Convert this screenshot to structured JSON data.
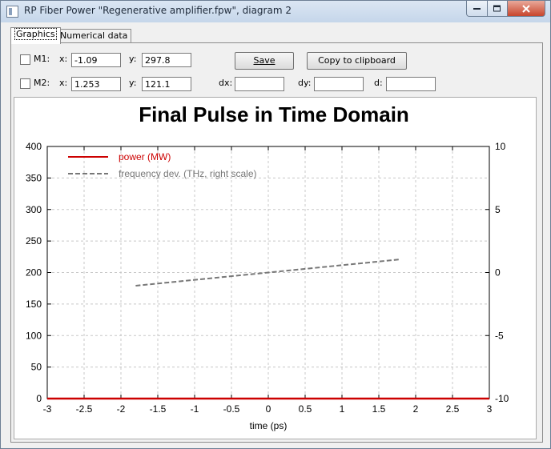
{
  "window": {
    "title": "RP Fiber Power \"Regenerative amplifier.fpw\", diagram 2",
    "controls": {
      "minimize": "minimize",
      "maximize": "maximize",
      "close": "close"
    }
  },
  "tabs": [
    {
      "label": "Graphics",
      "active": true
    },
    {
      "label": "Numerical data",
      "active": false
    }
  ],
  "markers": {
    "m1": {
      "label": "M1:",
      "x_label": "x:",
      "x": "-1.09",
      "y_label": "y:",
      "y": "297.8",
      "checked": false
    },
    "m2": {
      "label": "M2:",
      "x_label": "x:",
      "x": "1.253",
      "y_label": "y:",
      "y": "121.1",
      "checked": false
    },
    "dx_label": "dx:",
    "dx": "",
    "dy_label": "dy:",
    "dy": "",
    "d_label": "d:",
    "d": ""
  },
  "buttons": {
    "save": "Save",
    "copy": "Copy to clipboard"
  },
  "chart_data": {
    "type": "line",
    "title": "Final Pulse in Time Domain",
    "xlabel": "time (ps)",
    "ylabel": "",
    "y2label": "",
    "xlim": [
      -3,
      3
    ],
    "ylim": [
      0,
      400
    ],
    "y2lim": [
      -10,
      10
    ],
    "xticks": [
      -3,
      -2.5,
      -2,
      -1.5,
      -1,
      -0.5,
      0,
      0.5,
      1,
      1.5,
      2,
      2.5,
      3
    ],
    "yticks": [
      0,
      50,
      100,
      150,
      200,
      250,
      300,
      350,
      400
    ],
    "y2ticks": [
      -10,
      -5,
      0,
      5,
      10
    ],
    "grid": true,
    "legend_position": "top-left",
    "series": [
      {
        "name": "power (MW)",
        "axis": "left",
        "style": "solid",
        "color": "#cc0000",
        "x": [
          -3,
          -2,
          -1,
          0,
          1,
          2,
          3
        ],
        "y": [
          0,
          0,
          0,
          0,
          0,
          0,
          0
        ]
      },
      {
        "name": "frequency dev. (THz, right scale)",
        "axis": "right",
        "style": "dashed",
        "color": "#777777",
        "x": [
          -1.8,
          -1.2,
          -0.6,
          0,
          0.6,
          1.2,
          1.8
        ],
        "y": [
          -1.05,
          -0.7,
          -0.35,
          0,
          0.35,
          0.7,
          1.05
        ]
      }
    ]
  },
  "colors": {
    "power_series": "#cc0000",
    "frequency_series": "#777777",
    "grid": "#c8c8c8"
  }
}
